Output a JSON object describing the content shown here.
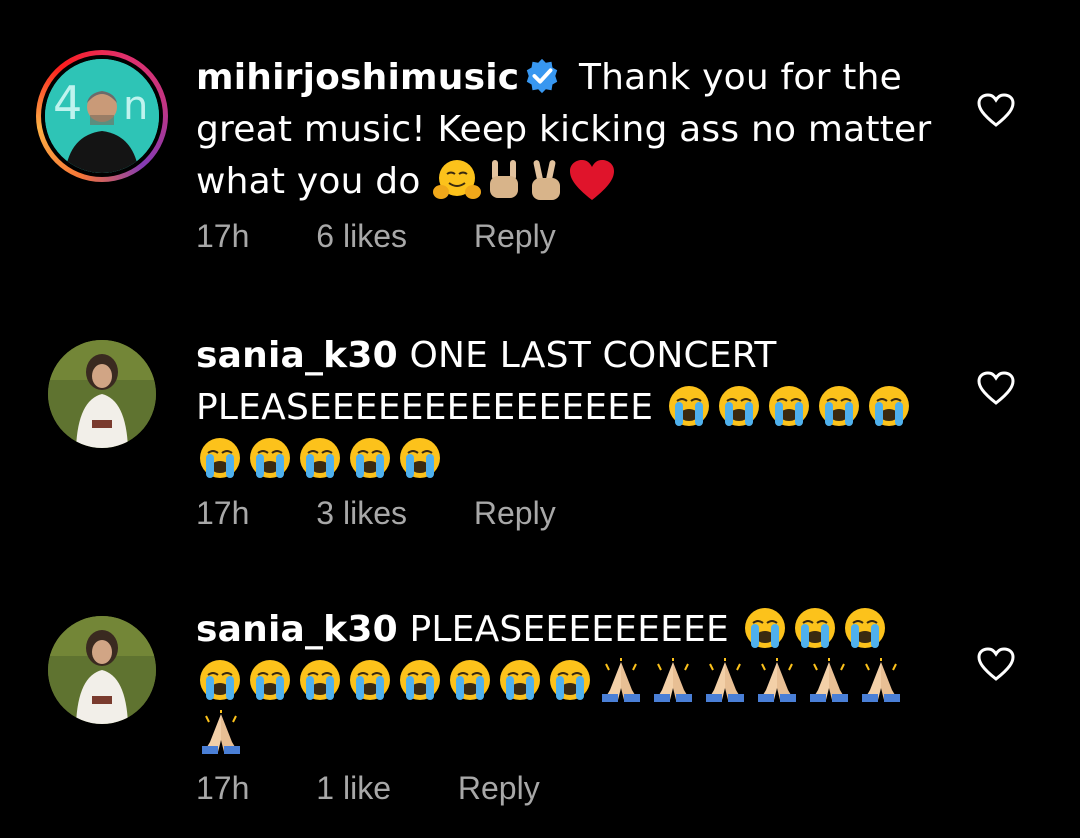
{
  "comments": [
    {
      "username": "mihirjoshimusic",
      "verified": true,
      "text": " Thank you for the great music! Keep kicking ass no matter what you do ",
      "emojis": [
        "hugging-face",
        "sign-of-horns",
        "victory-hand",
        "red-heart"
      ],
      "time": "17h",
      "likes": "6 likes",
      "reply": "Reply"
    },
    {
      "username": "sania_k30",
      "verified": false,
      "text": " ONE LAST CONCERT PLEASEEEEEEEEEEEEEEE ",
      "emojis_desc": "10 x loudly-crying-face",
      "time": "17h",
      "likes": "3 likes",
      "reply": "Reply"
    },
    {
      "username": "sania_k30",
      "verified": false,
      "text": " PLEASEEEEEEEEE ",
      "emojis_desc": "11 x loudly-crying-face, 7 x folded-hands",
      "time": "17h",
      "likes": "1 like",
      "reply": "Reply"
    }
  ],
  "colors": {
    "background": "#000000",
    "text": "#ffffff",
    "meta": "#a8a8a8",
    "verified": "#3897f0"
  }
}
